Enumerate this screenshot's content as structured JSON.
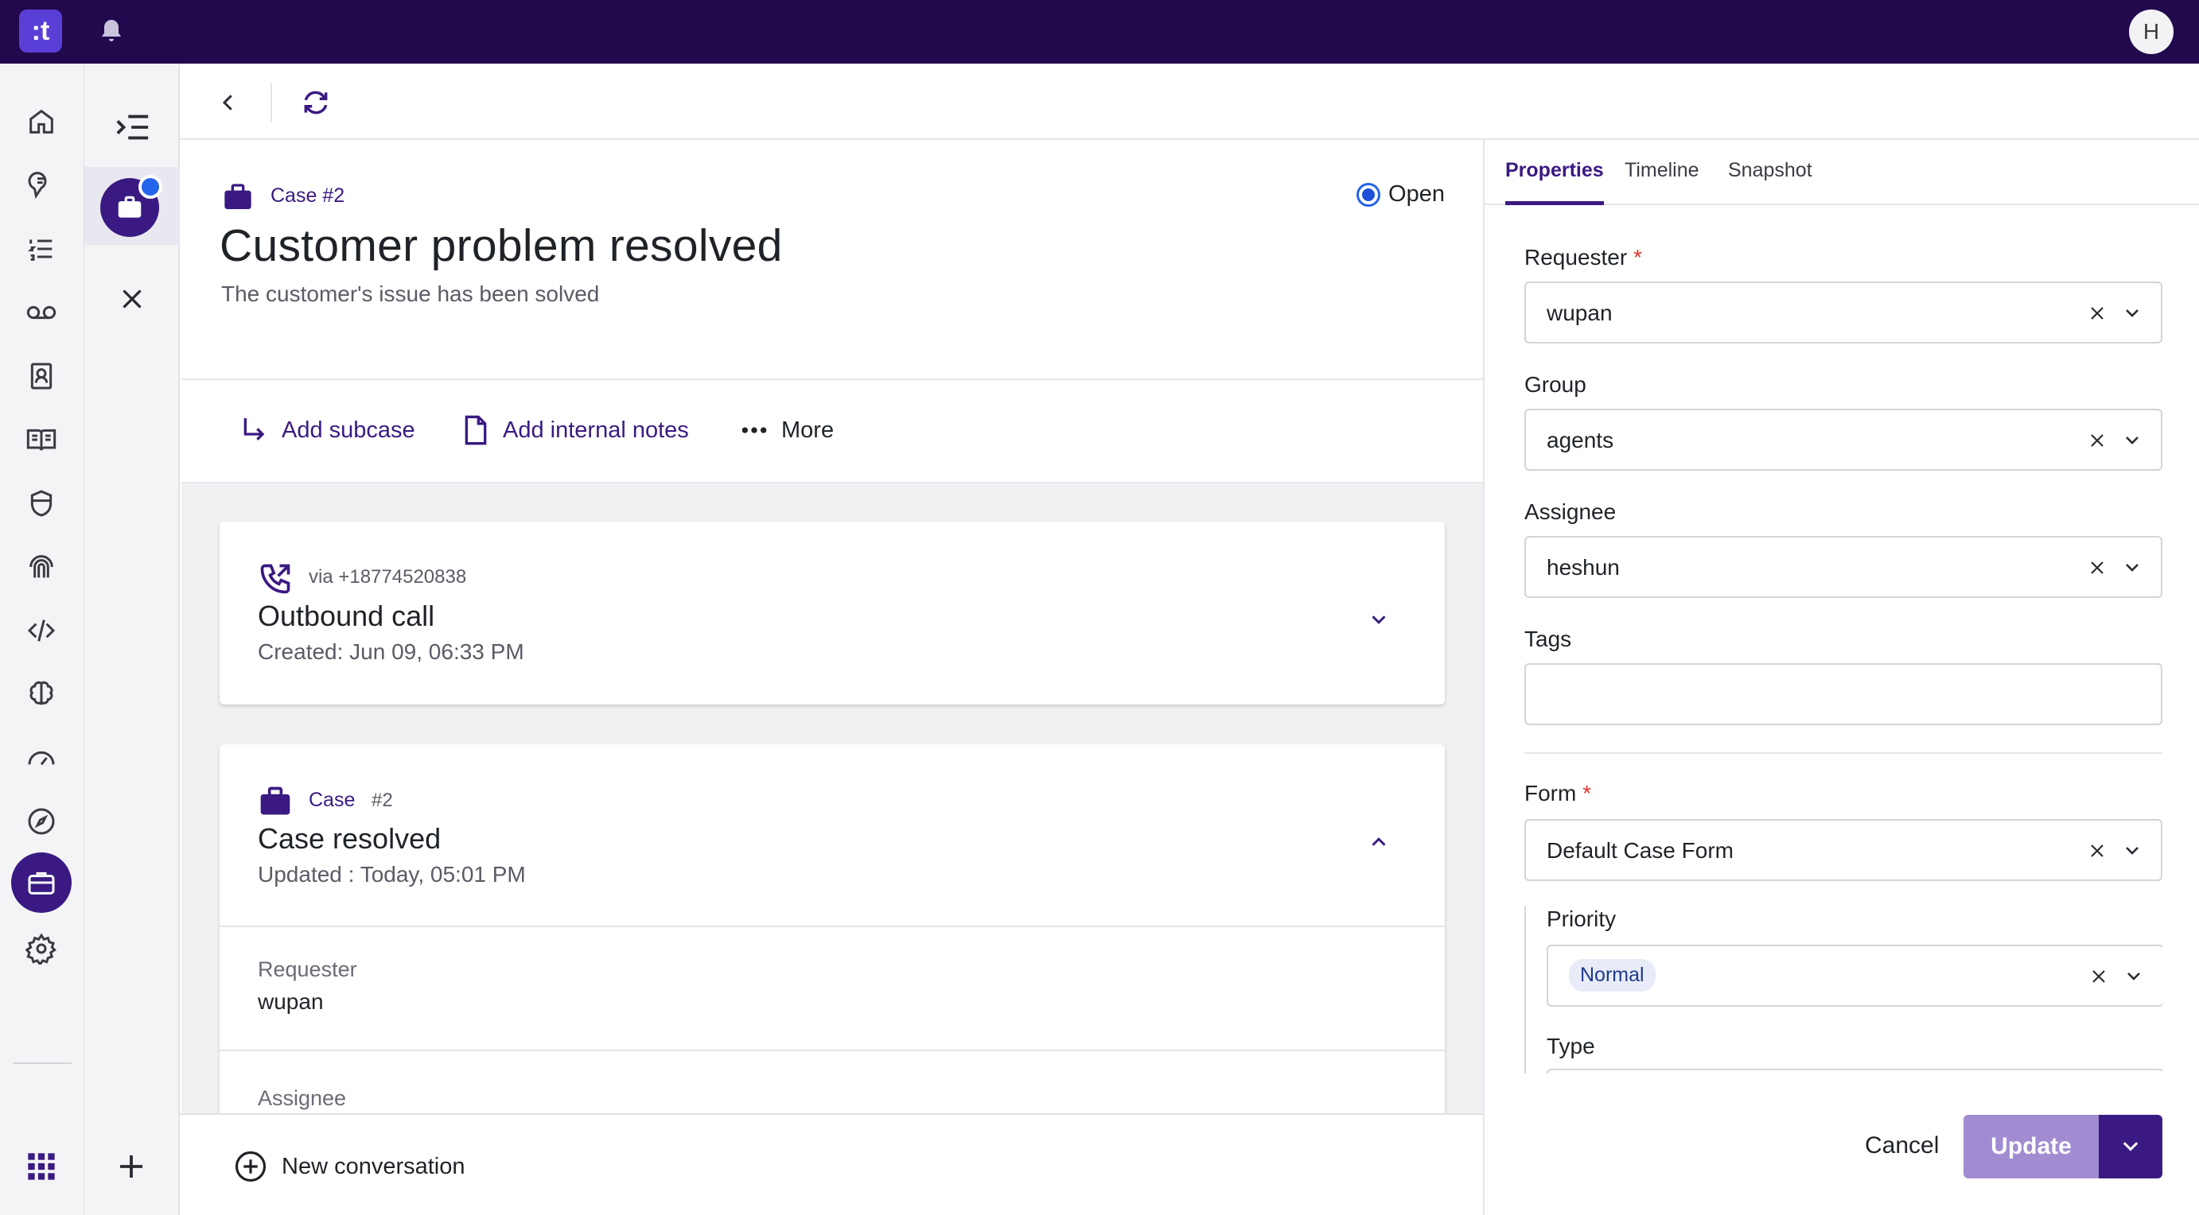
{
  "app": {
    "logo_text": ":t",
    "user_initial": "H",
    "accent_color": "#3a1a82",
    "topbar_color": "#22094e"
  },
  "left_nav": {
    "items": [
      "home-icon",
      "conversation-icon",
      "list-icon",
      "voicemail-icon",
      "contacts-icon",
      "knowledge-book-icon",
      "shield-icon",
      "fingerprint-icon",
      "code-icon",
      "ai-brain-icon",
      "dashboard-icon",
      "explore-icon",
      "cases-briefcase-icon",
      "settings-gear-icon"
    ],
    "active": "cases-briefcase-icon"
  },
  "case": {
    "id_label": "Case #2",
    "status": "Open",
    "title": "Customer problem resolved",
    "description": "The customer's issue has been solved"
  },
  "actions": {
    "add_subcase": "Add subcase",
    "add_notes": "Add internal notes",
    "more": "More"
  },
  "feed": {
    "call": {
      "via": "via +18774520838",
      "title": "Outbound call",
      "created": "Created: Jun 09, 06:33 PM"
    },
    "case_card": {
      "type": "Case",
      "number": "#2",
      "title": "Case resolved",
      "updated": "Updated : Today, 05:01 PM",
      "fields": [
        {
          "label": "Requester",
          "value": "wupan"
        },
        {
          "label": "Assignee",
          "value": ""
        }
      ]
    }
  },
  "bottom": {
    "new_conversation": "New conversation"
  },
  "panel": {
    "tabs": [
      "Properties",
      "Timeline",
      "Snapshot"
    ],
    "active_tab": "Properties",
    "requester_label": "Requester",
    "requester_value": "wupan",
    "group_label": "Group",
    "group_value": "agents",
    "assignee_label": "Assignee",
    "assignee_value": "heshun",
    "tags_label": "Tags",
    "form_label": "Form",
    "form_value": "Default Case Form",
    "priority_label": "Priority",
    "priority_value": "Normal",
    "type_label": "Type",
    "required_mark": "*",
    "cancel": "Cancel",
    "update": "Update"
  }
}
